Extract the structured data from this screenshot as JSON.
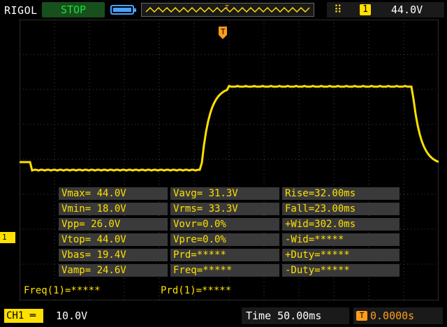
{
  "header": {
    "brand": "RIGOL",
    "run_status": "STOP",
    "trigger": {
      "edge_icon": "rising-edge-icon",
      "channel": "1",
      "level": "44.0V"
    }
  },
  "colors": {
    "trace": "#ffe000",
    "stop": "#17e23a",
    "trigger": "#ff9d1a",
    "grid": "#505050"
  },
  "measurements": [
    [
      "Vmax= 44.0V",
      "Vavg= 31.3V",
      "Rise=32.00ms"
    ],
    [
      "Vmin= 18.0V",
      "Vrms= 33.3V",
      "Fall=23.00ms"
    ],
    [
      "Vpp= 26.0V",
      "Vovr=0.0%",
      "+Wid=302.0ms"
    ],
    [
      "Vtop= 44.0V",
      "Vpre=0.0%",
      "-Wid=*****"
    ],
    [
      "Vbas= 19.4V",
      "Prd=*****",
      "+Duty=*****"
    ],
    [
      "Vamp= 24.6V",
      "Freq=*****",
      "-Duty=*****"
    ]
  ],
  "counters": {
    "freq": "Freq(1)=*****",
    "prd": "Prd(1)=*****"
  },
  "footer": {
    "ch1_label": "CH1",
    "ch1_scale": "10.0V",
    "timebase": "Time 50.00ms",
    "trigger_offset": "0.0000s"
  },
  "ch1_marker": "1",
  "trigger_marker": "T"
}
